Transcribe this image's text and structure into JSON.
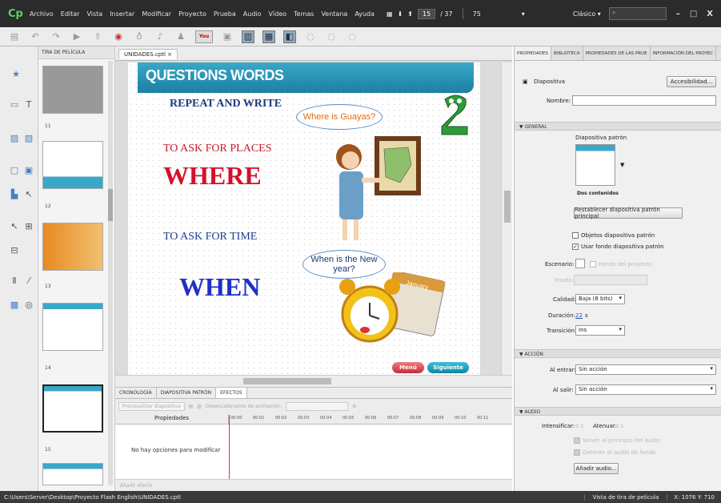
{
  "menubar": {
    "logo": "Cp",
    "items": [
      "Archivo",
      "Editar",
      "Vista",
      "Insertar",
      "Modificar",
      "Proyecto",
      "Prueba",
      "Audio",
      "Vídeo",
      "Temas",
      "Ventana",
      "Ayuda"
    ],
    "current_slide": "15",
    "total_slides": "/ 37",
    "zoom": "75",
    "workspace": "Clásico",
    "window_controls": [
      "–",
      "□",
      "X"
    ]
  },
  "filmstrip": {
    "tab": "TIRA DE PELÍCULA",
    "slide_numbers": [
      "11",
      "12",
      "13",
      "14",
      "15"
    ]
  },
  "document": {
    "tab_label": "UNIDADES.cptl ×"
  },
  "slide": {
    "banner": "QUESTIONS WORDS",
    "repeat": "REPEAT AND WRITE",
    "places": "TO ASK FOR PLACES",
    "where": "WHERE",
    "time": "TO ASK FOR TIME",
    "when": "WHEN",
    "bubble1": "Where is Guayas?",
    "bubble2": "When is the New year?",
    "calendar": "January",
    "menu_btn": "Menú",
    "next_btn": "Siguiente"
  },
  "timeline": {
    "tabs": [
      "CRONOLOGÍA",
      "DIAPOSITIVA PATRÓN",
      "EFECTOS"
    ],
    "preview": "Previsualizar diapositiva",
    "anim_label": "Desencadenante de animación:",
    "props_header": "Propiedades",
    "ruler": [
      "00:00",
      "00:01",
      "00:02",
      "00:03",
      "00:04",
      "00:05",
      "00:06",
      "00:07",
      "00:08",
      "00:09",
      "00:10",
      "00:11"
    ],
    "no_options": "No hay opciones para modificar",
    "add_effect": "Añadir efecto"
  },
  "properties": {
    "tabs": [
      "PROPIEDADES",
      "BIBLIOTECA",
      "PROPIEDADES DE LAS PRUE",
      "INFORMACIÓN DEL PROYEC"
    ],
    "object": "Diapositiva",
    "accessibility_btn": "Accesibilidad...",
    "name_label": "Nombre:",
    "name_value": "",
    "general": "GENERAL",
    "master_label": "Diapositiva patrón",
    "master_name": "Dos contenidos",
    "reset_btn": "Restablecer diapositiva patrón principal",
    "chk_objects": "Objetos diapositiva patrón",
    "chk_background": "Usar fondo diapositiva patrón",
    "stage_label": "Escenario:",
    "project_bg": "Fondo del proyecto",
    "bg_label": "Fondo:",
    "quality_label": "Calidad:",
    "quality_value": "Baja (8 bits)",
    "duration_label": "Duración:",
    "duration_value": "22",
    "duration_unit": "s",
    "transition_label": "Transición:",
    "transition_value": "Ins",
    "action": "ACCIÓN",
    "on_enter_label": "Al entrar:",
    "on_enter_value": "Sin acción",
    "on_exit_label": "Al salir:",
    "on_exit_value": "Sin acción",
    "audio": "AUDIO",
    "fade_in": "Intensificar:",
    "fade_in_val": "0 s",
    "fade_out": "Atenuar:",
    "fade_out_val": "0 s",
    "chk_loop": "Volver al principio del audio",
    "chk_stop": "Detener el audio de fondo",
    "add_audio_btn": "Añadir audio..."
  },
  "statusbar": {
    "path": "C:\\Users\\Server\\Desktop\\Proyecto Flash English\\UNIDADES.cptl",
    "view": "Vista de tira de película",
    "coords": "X: 1076 Y: 710"
  }
}
